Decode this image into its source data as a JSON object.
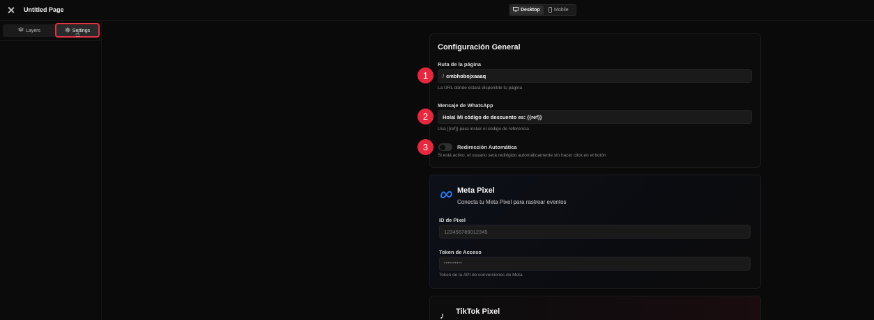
{
  "topbar": {
    "title": "Untitled Page",
    "close_icon": "close-icon",
    "devices": [
      {
        "label": "Desktop",
        "icon": "monitor-icon",
        "active": true
      },
      {
        "label": "Mobile",
        "icon": "phone-icon",
        "active": false
      }
    ]
  },
  "sidebar": {
    "tabs": [
      {
        "label": "Layers",
        "icon": "layers-icon"
      },
      {
        "label": "Settings",
        "icon": "gear-icon"
      }
    ]
  },
  "general": {
    "title": "Configuración General",
    "route": {
      "label": "Ruta de la página",
      "prefix": "/",
      "value": "cmbhobojxaaaq",
      "helper": "La URL donde estará disponible tu página"
    },
    "whatsapp": {
      "label": "Mensaje de WhatsApp",
      "value": "Hola! Mi código de descuento es: {{ref}}",
      "helper": "Usa {{ref}} para incluir el código de referencia"
    },
    "redirect": {
      "label": "Redirección Automática",
      "helper": "Si está activo, el usuario será redirigido automáticamente sin hacer click en el botón",
      "enabled": false
    }
  },
  "annotations": {
    "badge_1": "1",
    "badge_2": "2",
    "badge_3": "3",
    "color": "#e6283f"
  },
  "meta": {
    "title": "Meta Pixel",
    "subtitle": "Conecta tu Meta Pixel para rastrear eventos",
    "pixel_label": "ID de Pixel",
    "pixel_placeholder": "123456789012345",
    "token_label": "Token de Acceso",
    "token_placeholder": "••••••••••",
    "token_helper": "Token de la API de conversiones de Meta",
    "accent": "#1877f2"
  },
  "tiktok": {
    "title": "TikTok Pixel"
  }
}
